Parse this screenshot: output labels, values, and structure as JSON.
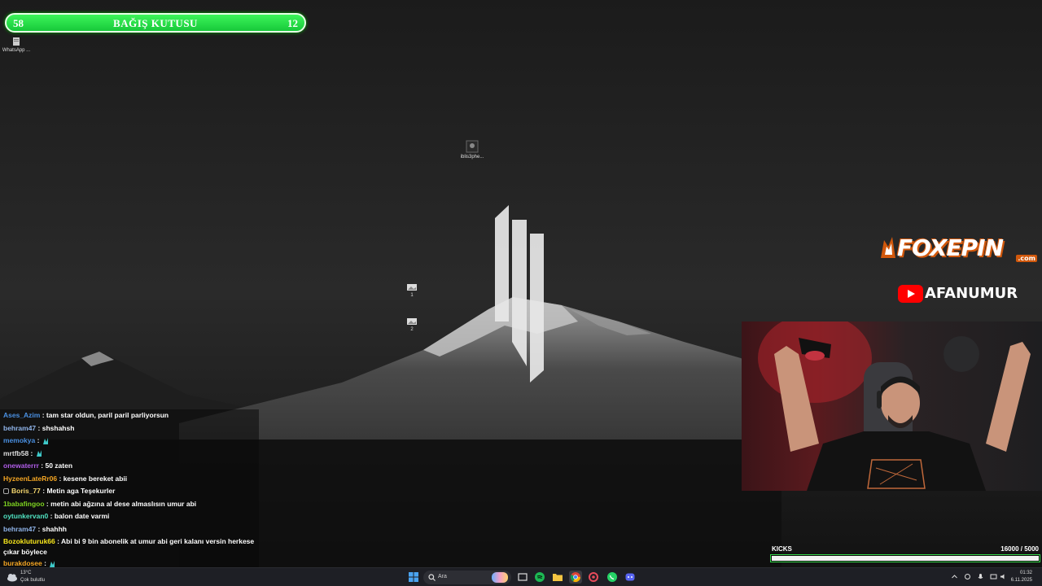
{
  "donation": {
    "left_value": "58",
    "title": "BAĞIŞ KUTUSU",
    "right_value": "12"
  },
  "desktop": {
    "icons": [
      {
        "label": "WhatsApp ..."
      },
      {
        "label": "iblis3phe..."
      },
      {
        "label": "1"
      },
      {
        "label": "2"
      }
    ]
  },
  "overlay": {
    "sponsor": "FOXEPIN",
    "sponsor_suffix": ".com",
    "youtube_name": "AFANUMUR"
  },
  "chat": {
    "messages": [
      {
        "user": "Ases_Azim",
        "color": "#4a90e2",
        "text": " : tam star oldun, paril paril parliyorsun"
      },
      {
        "user": "behram47",
        "color": "#8fb3e8",
        "text": " : shshahsh"
      },
      {
        "user": "memokya",
        "color": "#4a90e2",
        "text": " : ",
        "emote": true
      },
      {
        "user": "mrtfb58",
        "color": "#dddddd",
        "text": " : ",
        "emote": true
      },
      {
        "user": "onewaterrr",
        "color": "#b05de8",
        "text": " : 50 zaten"
      },
      {
        "user": "HyzeenLateRr06",
        "color": "#f5a623",
        "text": " : kesene bereket abii"
      },
      {
        "user": "Boris_77",
        "color": "#f5d76e",
        "text": " : Metin aga Teşekurler",
        "badge": true
      },
      {
        "user": "1babafingoo",
        "color": "#7ed321",
        "text": " : metin abi ağzına al dese almaslısın umur abi"
      },
      {
        "user": "oytunkervan0",
        "color": "#50e3c2",
        "text": " : balon date varmi"
      },
      {
        "user": "behram47",
        "color": "#8fb3e8",
        "text": " : shahhh"
      },
      {
        "user": "Bozokluturuk66",
        "color": "#f8e71c",
        "text": " : Abi bi 9 bin abonelik at umur abi geri kalanı versin herkese çıkar böylece"
      },
      {
        "user": "burakdosee",
        "color": "#f5a623",
        "text": " : ",
        "emote": true
      }
    ]
  },
  "kicks": {
    "label": "KICKS",
    "current": "16000",
    "goal": "/ 5000",
    "progress": 1.0
  },
  "taskbar": {
    "weather_temp": "13°C",
    "weather_condition": "Çok bulutlu",
    "search_placeholder": "Ara",
    "time": "01:32",
    "date": "6.11.2025"
  },
  "colors": {
    "donation_green": "#2ee34c",
    "kicks_border": "#35d84a",
    "taskbar_bg": "#1e1f25"
  }
}
